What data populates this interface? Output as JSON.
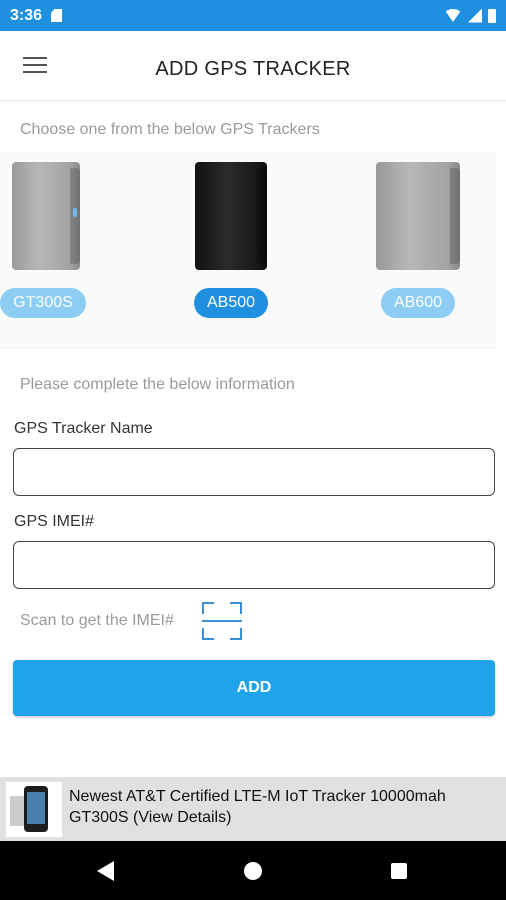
{
  "status_bar": {
    "time": "3:36",
    "icons": [
      "sd-card-icon",
      "wifi-icon",
      "signal-icon",
      "battery-icon"
    ]
  },
  "header": {
    "title": "ADD GPS TRACKER",
    "menu_icon": "hamburger-menu-icon"
  },
  "tracker_section": {
    "hint": "Choose one from the below GPS Trackers",
    "trackers": [
      {
        "label": "GT300S",
        "selected": false,
        "device_color": "gray"
      },
      {
        "label": "AB500",
        "selected": true,
        "device_color": "black"
      },
      {
        "label": "AB600",
        "selected": false,
        "device_color": "gray"
      }
    ]
  },
  "form": {
    "hint": "Please complete the below information",
    "name_label": "GPS Tracker Name",
    "name_value": "",
    "imei_label": "GPS IMEI#",
    "imei_value": "",
    "scan_label": "Scan to get the IMEI#",
    "scan_icon": "qr-scan-icon",
    "add_label": "ADD"
  },
  "promo": {
    "line1": "Newest AT&T Certified LTE-M IoT Tracker 10000mah",
    "line2": "GT300S (View Details)"
  },
  "nav_bar": {
    "icons": [
      "back-icon",
      "home-icon",
      "recents-icon"
    ]
  },
  "colors": {
    "primary": "#1f8fe0",
    "button": "#1fa3ea",
    "pill_inactive": "#8dccf3",
    "hint_text": "#9a9a9a"
  }
}
